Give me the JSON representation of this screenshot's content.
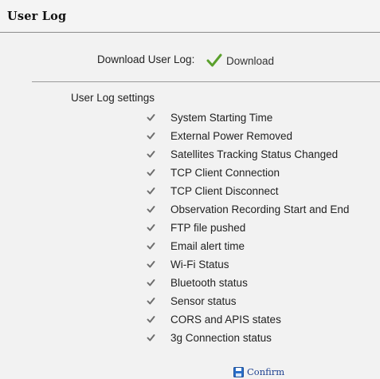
{
  "header": {
    "title": "User Log"
  },
  "download": {
    "label": "Download User Log:",
    "link_label": "Download",
    "icon": "green-check-icon"
  },
  "settings": {
    "label": "User Log settings",
    "items": [
      {
        "label": "System Starting Time",
        "checked": true
      },
      {
        "label": "External Power Removed",
        "checked": true
      },
      {
        "label": "Satellites Tracking Status Changed",
        "checked": true
      },
      {
        "label": "TCP Client Connection",
        "checked": true
      },
      {
        "label": "TCP Client Disconnect",
        "checked": true
      },
      {
        "label": "Observation Recording Start and End",
        "checked": true
      },
      {
        "label": "FTP file pushed",
        "checked": true
      },
      {
        "label": "Email alert time",
        "checked": true
      },
      {
        "label": "Wi-Fi Status",
        "checked": true
      },
      {
        "label": "Bluetooth status",
        "checked": true
      },
      {
        "label": "Sensor status",
        "checked": true
      },
      {
        "label": "CORS and APIS states",
        "checked": true
      },
      {
        "label": "3g Connection status",
        "checked": true
      }
    ]
  },
  "confirm": {
    "label": "Confirm",
    "icon": "floppy-disk-icon"
  },
  "colors": {
    "accent_green": "#5aa02c",
    "link_blue": "#1c3f8f",
    "checkbox_gray": "#6e6e6e"
  }
}
